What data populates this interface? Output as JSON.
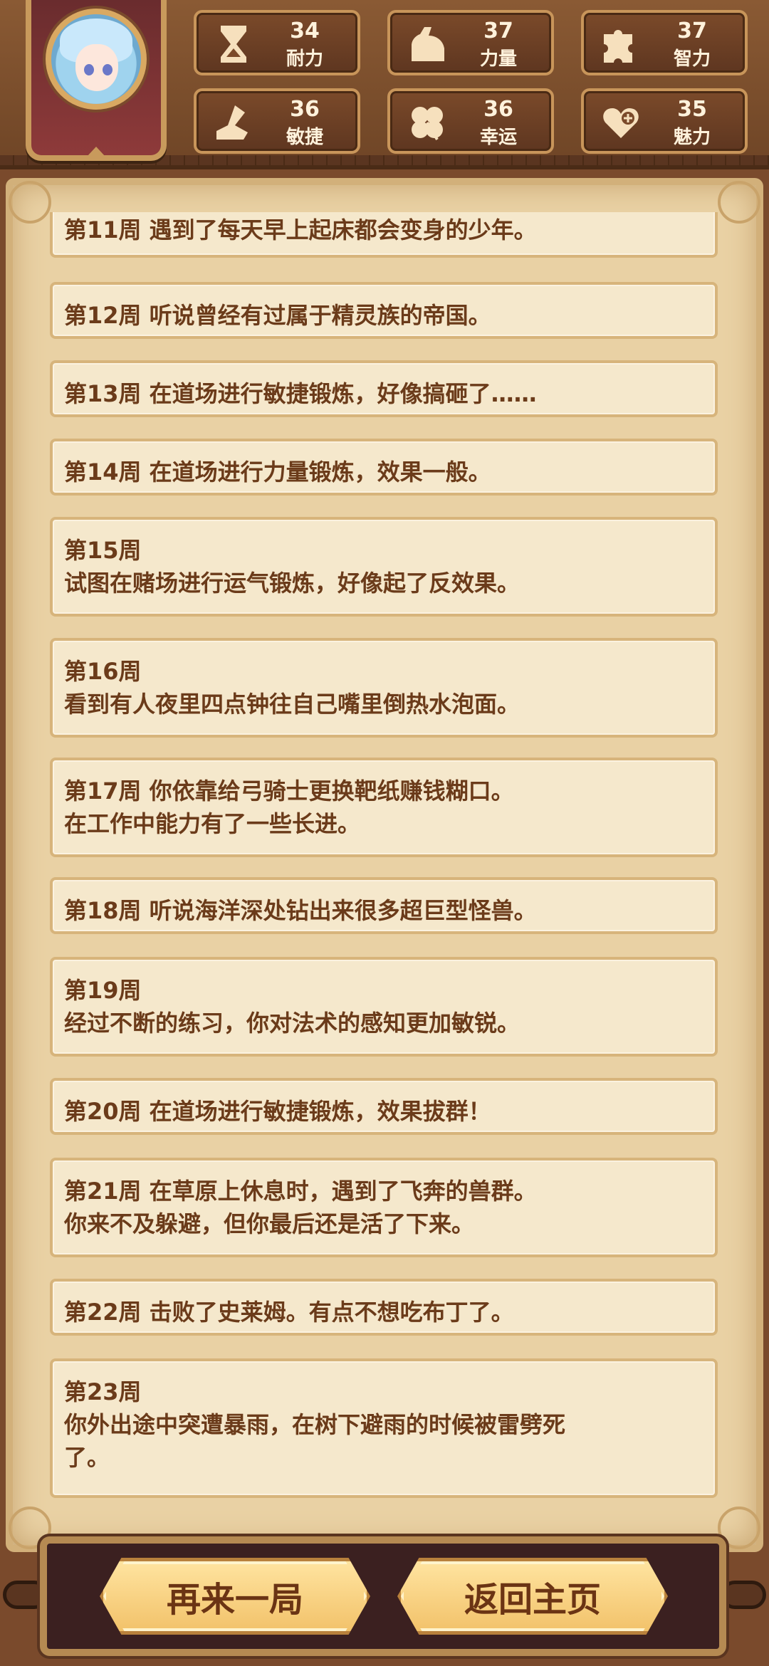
{
  "stats": [
    {
      "value": "34",
      "label": "耐力",
      "icon": "hourglass-icon"
    },
    {
      "value": "37",
      "label": "力量",
      "icon": "flexed-arm-icon"
    },
    {
      "value": "37",
      "label": "智力",
      "icon": "puzzle-icon"
    },
    {
      "value": "36",
      "label": "敏捷",
      "icon": "boot-icon"
    },
    {
      "value": "36",
      "label": "幸运",
      "icon": "clover-icon"
    },
    {
      "value": "35",
      "label": "魅力",
      "icon": "heart-plus-icon"
    }
  ],
  "log": [
    {
      "lines": [
        "第11周 遇到了每天早上起床都会变身的少年。"
      ]
    },
    {
      "lines": [
        "第12周 听说曾经有过属于精灵族的帝国。"
      ]
    },
    {
      "lines": [
        "第13周 在道场进行敏捷锻炼，好像搞砸了……"
      ]
    },
    {
      "lines": [
        "第14周 在道场进行力量锻炼，效果一般。"
      ]
    },
    {
      "lines": [
        "第15周",
        "试图在赌场进行运气锻炼，好像起了反效果。"
      ]
    },
    {
      "lines": [
        "第16周",
        "看到有人夜里四点钟往自己嘴里倒热水泡面。"
      ]
    },
    {
      "lines": [
        "第17周 你依靠给弓骑士更换靶纸赚钱糊口。",
        "在工作中能力有了一些长进。"
      ]
    },
    {
      "lines": [
        "第18周 听说海洋深处钻出来很多超巨型怪兽。"
      ]
    },
    {
      "lines": [
        "第19周",
        "经过不断的练习，你对法术的感知更加敏锐。"
      ]
    },
    {
      "lines": [
        "第20周 在道场进行敏捷锻炼，效果拔群！"
      ]
    },
    {
      "lines": [
        "第21周 在草原上休息时，遇到了飞奔的兽群。",
        "你来不及躲避，但你最后还是活了下来。"
      ]
    },
    {
      "lines": [
        "第22周 击败了史莱姆。有点不想吃布丁了。"
      ]
    },
    {
      "lines": [
        "第23周",
        "你外出途中突遭暴雨，在树下避雨的时候被雷劈死",
        "了。"
      ]
    }
  ],
  "buttons": {
    "retry": "再来一局",
    "home": "返回主页"
  }
}
